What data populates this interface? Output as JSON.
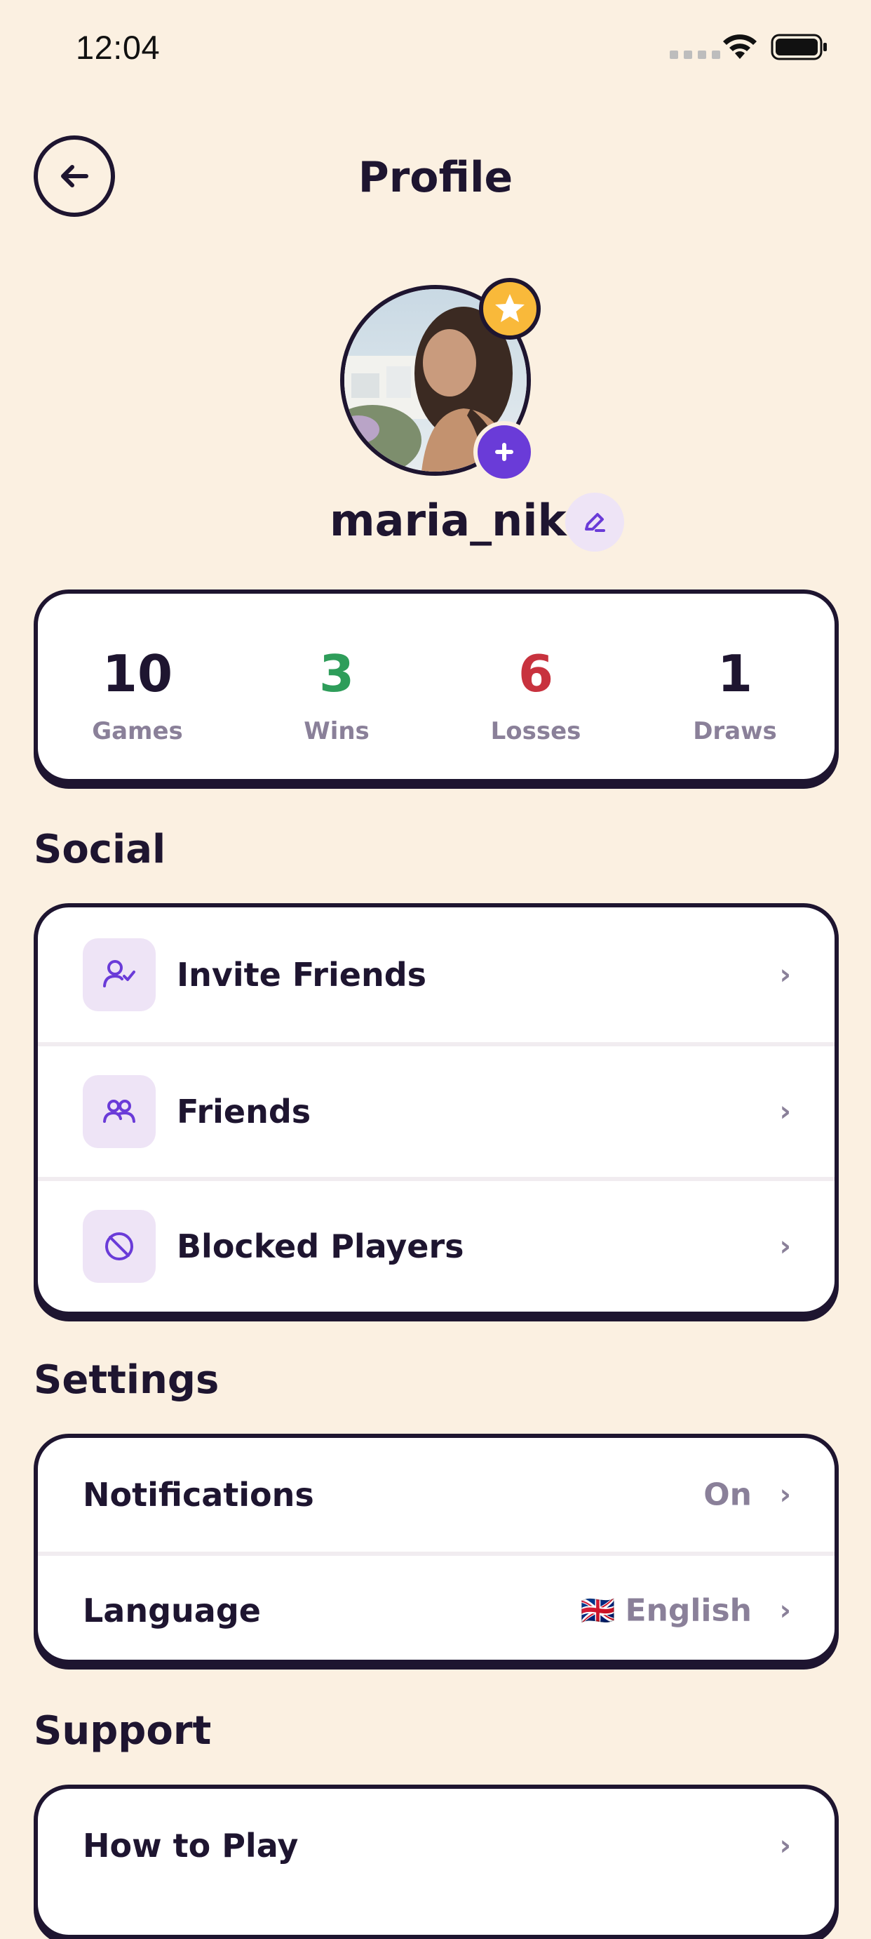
{
  "status_bar": {
    "time": "12:04"
  },
  "header": {
    "title": "Profile",
    "back_icon": "arrow-left-icon"
  },
  "profile": {
    "username": "maria_nik",
    "badge_icon": "star-icon",
    "add_icon": "plus-icon",
    "edit_icon": "pencil-icon"
  },
  "stats": [
    {
      "value": "10",
      "label": "Games",
      "color": "#1E1530"
    },
    {
      "value": "3",
      "label": "Wins",
      "color": "#2E9D5A"
    },
    {
      "value": "6",
      "label": "Losses",
      "color": "#C8323E"
    },
    {
      "value": "1",
      "label": "Draws",
      "color": "#1E1530"
    }
  ],
  "social": {
    "title": "Social",
    "items": [
      {
        "label": "Invite Friends",
        "icon": "user-check-icon"
      },
      {
        "label": "Friends",
        "icon": "users-icon"
      },
      {
        "label": "Blocked Players",
        "icon": "block-icon"
      }
    ]
  },
  "settings": {
    "title": "Settings",
    "items": [
      {
        "label": "Notifications",
        "value": "On"
      },
      {
        "label": "Language",
        "value": "English",
        "flag": "🇬🇧"
      }
    ]
  },
  "support": {
    "title": "Support",
    "items": [
      {
        "label": "How to Play"
      }
    ]
  },
  "colors": {
    "background": "#FBF0E1",
    "accent": "#6A3BD8",
    "star": "#F9B93A",
    "text": "#1E1530",
    "muted": "#8A8099"
  }
}
